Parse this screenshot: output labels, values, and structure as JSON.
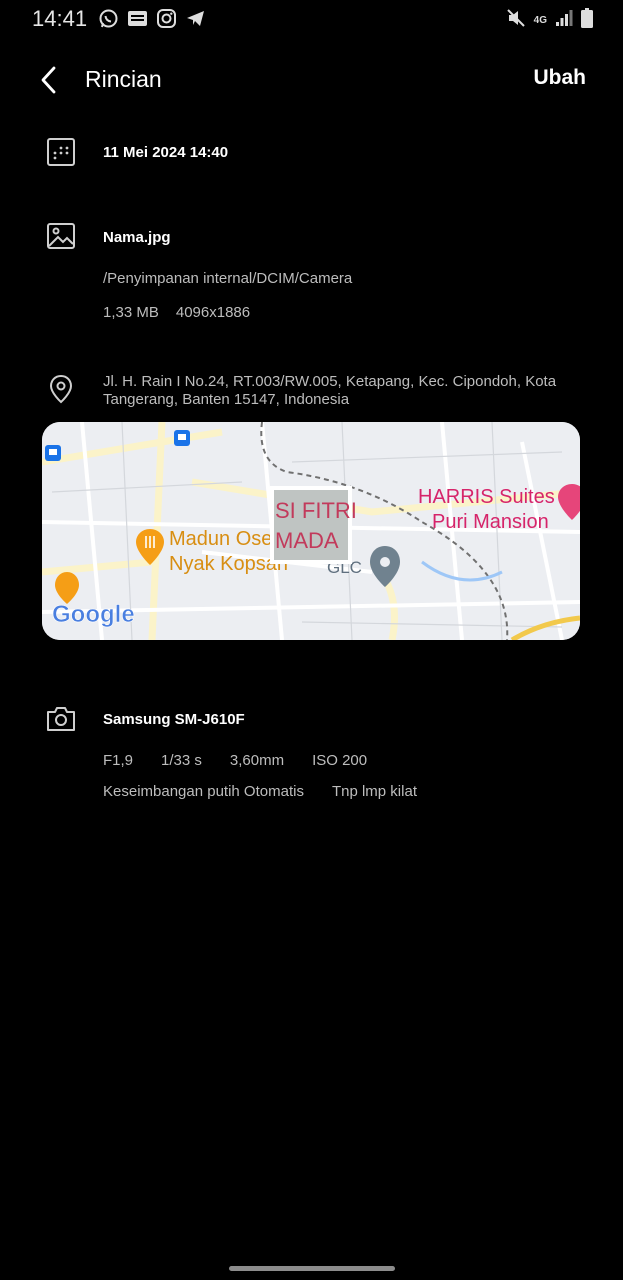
{
  "status_bar": {
    "time": "14:41",
    "icons_left": [
      "whatsapp-icon",
      "webtoon-icon",
      "instagram-icon",
      "telegram-icon"
    ],
    "network": "4G",
    "icons_right": [
      "mute-icon",
      "network-4g-icon",
      "signal-icon",
      "battery-icon"
    ]
  },
  "header": {
    "title": "Rincian",
    "edit_label": "Ubah"
  },
  "date_row": {
    "datetime": "11 Mei 2024 14:40",
    "icon": "calendar-icon"
  },
  "file_row": {
    "filename": "Nama.jpg",
    "path": "/Penyimpanan internal/DCIM/Camera",
    "size": "1,33 MB",
    "resolution": "4096x1886",
    "icon": "image-icon"
  },
  "location_row": {
    "address": "Jl. H. Rain I No.24, RT.003/RW.005, Ketapang, Kec. Cipondoh, Kota Tangerang, Banten 15147, Indonesia",
    "icon": "location-pin-icon",
    "map": {
      "labels": [
        "HARRIS Suites",
        "Puri Mansion",
        "Madun Ose",
        "Nyak Kopsan",
        "GLC"
      ],
      "thumbnail_text": [
        "SI FITRI",
        "MADA"
      ],
      "logo": "Google"
    }
  },
  "camera_row": {
    "model": "Samsung SM-J610F",
    "aperture": "F1,9",
    "exposure": "1/33 s",
    "focal_length": "3,60mm",
    "iso": "ISO 200",
    "white_balance": "Keseimbangan putih Otomatis",
    "flash": "Tnp lmp kilat",
    "icon": "camera-icon"
  },
  "colors": {
    "background": "#000000",
    "text_primary": "#ffffff",
    "text_secondary": "#bdbdbd"
  }
}
